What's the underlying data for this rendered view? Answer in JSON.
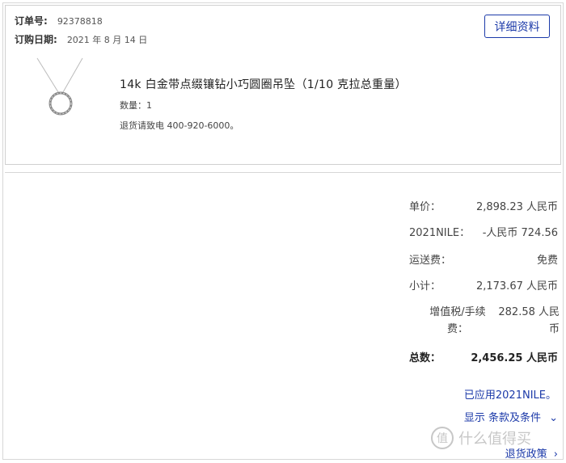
{
  "order": {
    "number_label": "订单号:",
    "number_value": "92378818",
    "date_label": "订购日期:",
    "date_value": "2021 年 8 月 14 日",
    "details_button": "详细资料"
  },
  "product": {
    "name": "14k 白金带点缀镶钻小巧圆圈吊坠（1/10 克拉总重量）",
    "quantity": "数量：1",
    "return_note": "退货请致电 400-920-6000。"
  },
  "summary": {
    "unit_price_label": "单价：",
    "unit_price_value": "2,898.23 人民币",
    "promo_label": "2021NILE：",
    "promo_value": "-人民币 724.56",
    "shipping_label": "运送费：",
    "shipping_value": "免费",
    "subtotal_label": "小计：",
    "subtotal_value": "2,173.67 人民币",
    "vat_label": "增值税/手续费：",
    "vat_value": "282.58 人民币",
    "total_label": "总数：",
    "total_value": "2,456.25 人民币"
  },
  "links": {
    "promo_applied": "已应用2021NILE。",
    "show_terms": "显示 条款及条件",
    "return_policy": "退货政策"
  },
  "watermark": {
    "text": "什么值得买",
    "icon": "值"
  },
  "colors": {
    "link": "#1c3aa9",
    "border": "#d0d0d0"
  }
}
